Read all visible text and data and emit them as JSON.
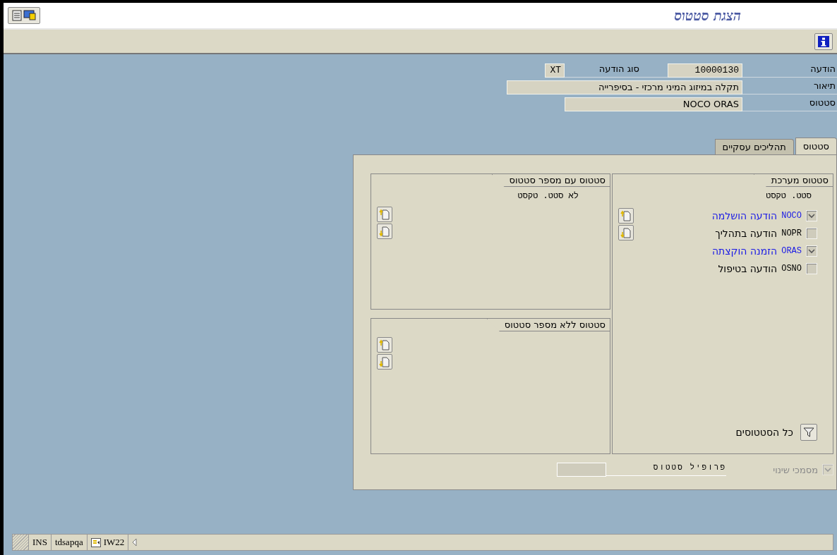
{
  "title": "הצגת סטטוס",
  "header": {
    "notification": {
      "label": "הודעה",
      "value": "10000130"
    },
    "notification_type": {
      "label": "סוג הודעה",
      "value": "XT"
    },
    "description": {
      "label": "תיאור",
      "value": "תקלה במיזוג המיני מרכזי  - בסיפרייה"
    },
    "status": {
      "label": "סטטוס",
      "value": "NOCO ORAS"
    }
  },
  "tabs": [
    {
      "label": "סטטוס",
      "selected": true
    },
    {
      "label": "תהליכים עסקיים",
      "selected": false
    }
  ],
  "system_status": {
    "title": "סטטוס מערכת",
    "columns_header": "סטט. טקסט",
    "rows": [
      {
        "code": "NOCO",
        "text": "הודעה הושלמה",
        "checked": true
      },
      {
        "code": "NOPR",
        "text": "הודעה בתהליך",
        "checked": false
      },
      {
        "code": "ORAS",
        "text": "הזמנה הוקצתה",
        "checked": true
      },
      {
        "code": "OSNO",
        "text": "הודעה בטיפול",
        "checked": false
      }
    ],
    "filter_label": "כל הסטטוסים"
  },
  "status_with_number": {
    "title": "סטטוס עם מספר סטטוס",
    "columns_header": "לא סטט. טקסט"
  },
  "status_without_number": {
    "title": "סטטוס ללא מספר סטטוס"
  },
  "change_documents": {
    "label": "מסמכי שינוי",
    "checked": true,
    "disabled": true
  },
  "status_profile": {
    "label": "פרופיל סטטוס"
  },
  "status_bar": [
    {
      "kind": "transaction",
      "label": "IW22"
    },
    {
      "kind": "text",
      "label": "tdsapqa"
    },
    {
      "kind": "text",
      "label": "INS"
    }
  ]
}
